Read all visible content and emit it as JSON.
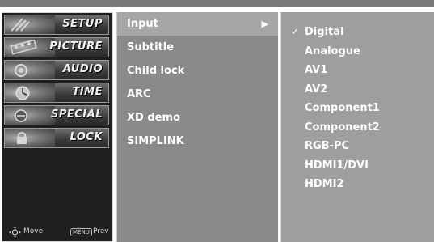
{
  "sidebar": {
    "items": [
      {
        "label": "SETUP",
        "icon": "satellite-dish-icon"
      },
      {
        "label": "PICTURE",
        "icon": "film-reel-icon"
      },
      {
        "label": "AUDIO",
        "icon": "speaker-icon"
      },
      {
        "label": "TIME",
        "icon": "clock-icon"
      },
      {
        "label": "SPECIAL",
        "icon": "special-badge-icon"
      },
      {
        "label": "LOCK",
        "icon": "lock-icon"
      }
    ],
    "legend": {
      "move_label": "Move",
      "menu_key_label": "MENU",
      "prev_label": "Prev"
    }
  },
  "submenu": {
    "items": [
      {
        "label": "Input",
        "selected": true,
        "arrow": "▶"
      },
      {
        "label": "Subtitle"
      },
      {
        "label": "Child lock"
      },
      {
        "label": "ARC"
      },
      {
        "label": "XD demo"
      },
      {
        "label": "SIMPLINK"
      }
    ]
  },
  "options": {
    "check_mark": "✓",
    "items": [
      {
        "label": "Digital",
        "checked": true
      },
      {
        "label": "Analogue"
      },
      {
        "label": "AV1"
      },
      {
        "label": "AV2"
      },
      {
        "label": "Component1"
      },
      {
        "label": "Component2"
      },
      {
        "label": "RGB-PC"
      },
      {
        "label": "HDMI1/DVI"
      },
      {
        "label": "HDMI2"
      }
    ]
  },
  "colors": {
    "sidebar_bg": "#1f1f1f",
    "submenu_bg": "#8a8a8a",
    "submenu_selected_bg": "#a6a6a6",
    "options_bg": "#9e9e9e",
    "text": "#ffffff"
  }
}
